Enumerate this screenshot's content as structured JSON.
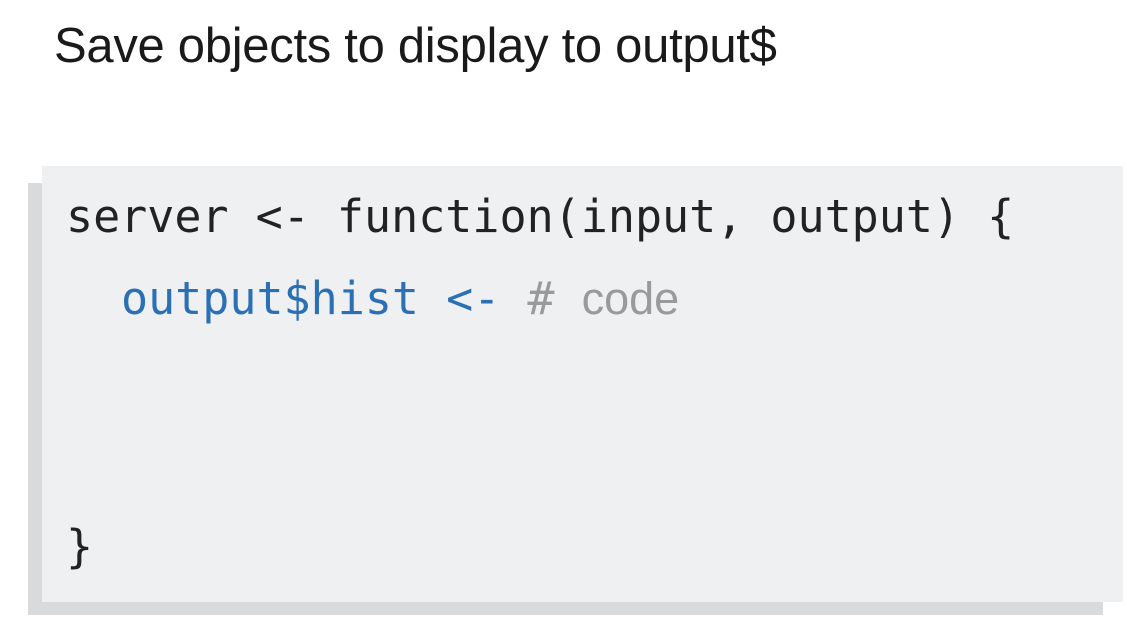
{
  "slide": {
    "title": "Save objects to display to output$"
  },
  "code": {
    "line1": "server <- function(input, output) {",
    "line2": {
      "target": "output$hist",
      "assign": " <- ",
      "hash": "# ",
      "comment": "code"
    },
    "line3": "}"
  },
  "colors": {
    "background": "#ffffff",
    "code_background": "#eef0f2",
    "code_shadow": "#d9dadc",
    "identifier_blue": "#2b6fb5",
    "comment_gray": "#9a9a9a",
    "text": "#222222"
  }
}
